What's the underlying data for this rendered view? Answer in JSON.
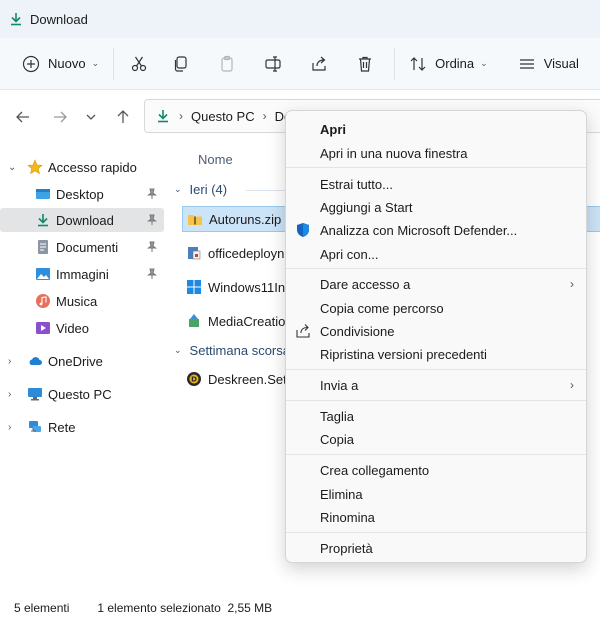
{
  "window": {
    "title": "Download"
  },
  "toolbar": {
    "new_label": "Nuovo",
    "sort_label": "Ordina",
    "view_label": "Visual"
  },
  "address": {
    "crumbs": [
      "Questo PC",
      "Do"
    ]
  },
  "sidebar": {
    "items": [
      {
        "label": "Accesso rapido",
        "icon": "star-icon"
      },
      {
        "label": "Desktop",
        "icon": "desktop-folder-icon"
      },
      {
        "label": "Download",
        "icon": "download-icon"
      },
      {
        "label": "Documenti",
        "icon": "documents-icon"
      },
      {
        "label": "Immagini",
        "icon": "pictures-icon"
      },
      {
        "label": "Musica",
        "icon": "music-icon"
      },
      {
        "label": "Video",
        "icon": "video-icon"
      },
      {
        "label": "OneDrive",
        "icon": "cloud-icon"
      },
      {
        "label": "Questo PC",
        "icon": "computer-icon"
      },
      {
        "label": "Rete",
        "icon": "network-icon"
      }
    ]
  },
  "content": {
    "column_name": "Nome",
    "groups": [
      {
        "label": "Ieri (4)"
      },
      {
        "label": "Settimana scorsa"
      }
    ],
    "files": [
      {
        "name": "Autoruns.zip",
        "icon": "zip-folder-icon"
      },
      {
        "name": "officedeployn",
        "icon": "installer-icon"
      },
      {
        "name": "Windows11Ins",
        "icon": "windows-icon"
      },
      {
        "name": "MediaCreatio",
        "icon": "media-creation-icon"
      },
      {
        "name": "Deskreen.Setu",
        "icon": "deskreen-icon"
      }
    ]
  },
  "status": {
    "count": "5 elementi",
    "selection": "1 elemento selezionato  2,55 MB"
  },
  "context_menu": {
    "items": [
      {
        "label": "Apri"
      },
      {
        "label": "Apri in una nuova finestra"
      },
      {
        "label": "Estrai tutto..."
      },
      {
        "label": "Aggiungi a Start"
      },
      {
        "label": "Analizza con Microsoft Defender..."
      },
      {
        "label": "Apri con..."
      },
      {
        "label": "Dare accesso a"
      },
      {
        "label": "Copia come percorso"
      },
      {
        "label": "Condivisione"
      },
      {
        "label": "Ripristina versioni precedenti"
      },
      {
        "label": "Invia a"
      },
      {
        "label": "Taglia"
      },
      {
        "label": "Copia"
      },
      {
        "label": "Crea collegamento"
      },
      {
        "label": "Elimina"
      },
      {
        "label": "Rinomina"
      },
      {
        "label": "Proprietà"
      }
    ]
  },
  "colors": {
    "accent": "#0f7b5f",
    "selection": "#cce4f7",
    "defender_blue": "#1565c0"
  }
}
